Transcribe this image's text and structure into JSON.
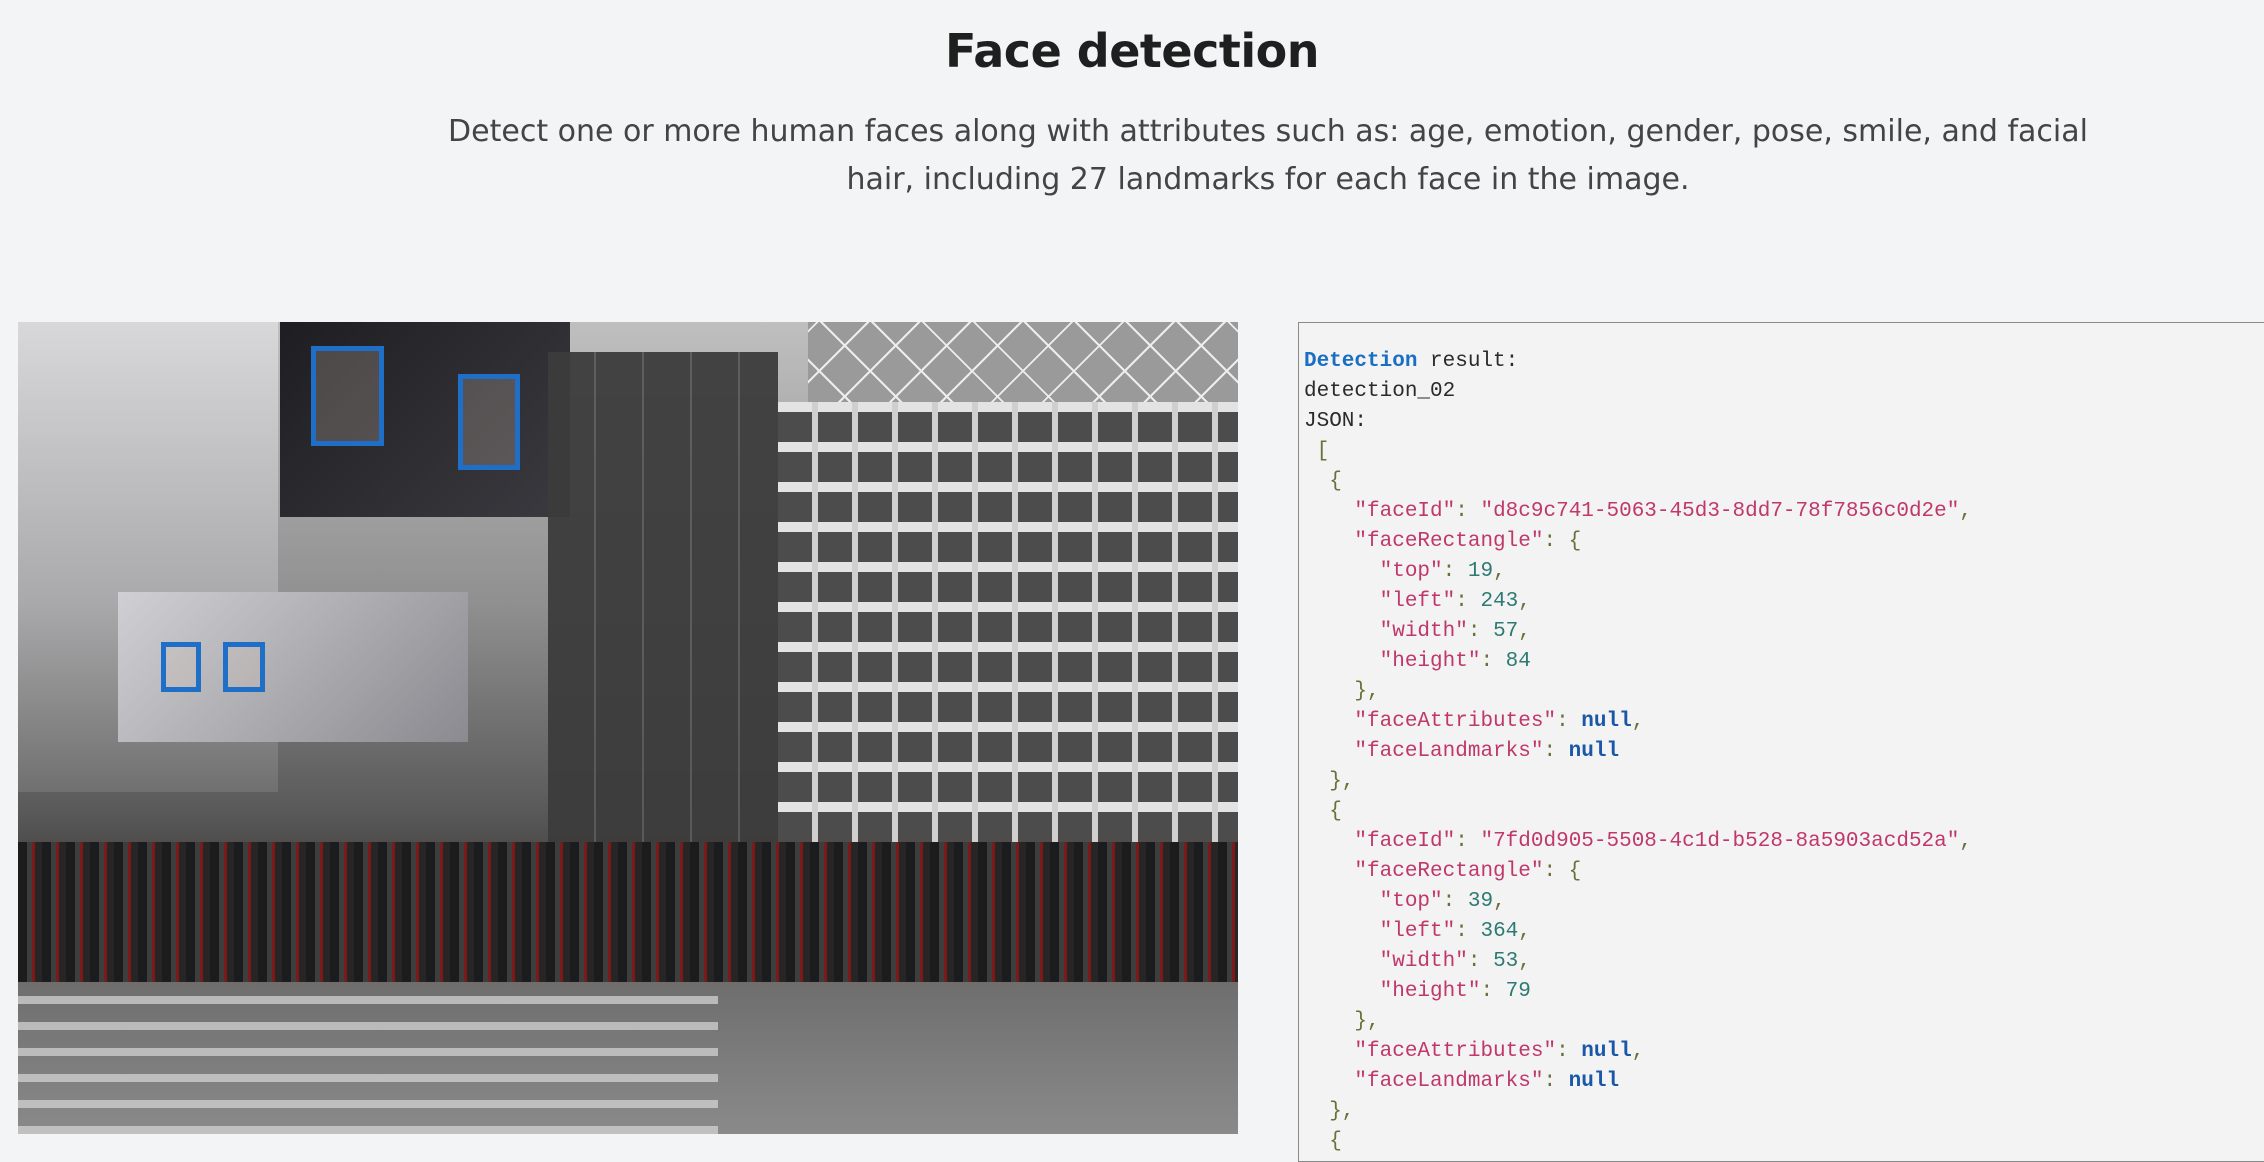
{
  "page": {
    "title": "Face detection",
    "subtitle": "Detect one or more human faces along with attributes such as: age, emotion, gender, pose, smile, and facial hair, including 27 landmarks for each face in the image."
  },
  "colors": {
    "face_box": "#1f6fc9",
    "keyword": "#1a6fc2",
    "json_key": "#c0386b",
    "json_number": "#2e7a73",
    "json_null": "#1a57a8"
  },
  "result": {
    "heading_keyword": "Detection",
    "heading_rest": " result:",
    "model": "detection_02",
    "json_label": "JSON:",
    "open_bracket": "[",
    "faces": [
      {
        "faceId": "d8c9c741-5063-45d3-8dd7-78f7856c0d2e",
        "top": "19",
        "left": "243",
        "width": "57",
        "height": "84",
        "faceAttributes": "null",
        "faceLandmarks": "null"
      },
      {
        "faceId": "7fd0d905-5508-4c1d-b528-8a5903acd52a",
        "top": "39",
        "left": "364",
        "width": "53",
        "height": "79",
        "faceAttributes": "null",
        "faceLandmarks": "null"
      }
    ]
  }
}
